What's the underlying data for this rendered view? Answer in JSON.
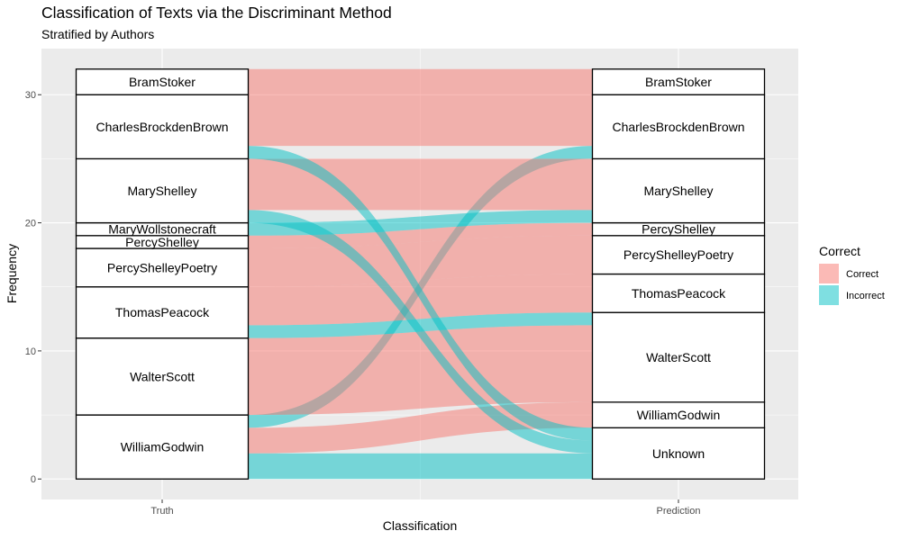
{
  "chart_data": {
    "type": "alluvial",
    "title": "Classification of Texts via the Discriminant Method",
    "subtitle": "Stratified by Authors",
    "xlabel": "Classification",
    "ylabel": "Frequency",
    "axes": [
      "Truth",
      "Prediction"
    ],
    "ylim": [
      -1.6,
      33.6
    ],
    "yticks": [
      0,
      10,
      20,
      30
    ],
    "legend": {
      "title": "Correct",
      "position": "right",
      "entries": [
        {
          "label": "Correct",
          "color": "#F8766D"
        },
        {
          "label": "Incorrect",
          "color": "#00BFC4"
        }
      ]
    },
    "truth_strata": [
      {
        "label": "WilliamGodwin",
        "count": 5
      },
      {
        "label": "WalterScott",
        "count": 6
      },
      {
        "label": "ThomasPeacock",
        "count": 4
      },
      {
        "label": "PercyShelleyPoetry",
        "count": 3
      },
      {
        "label": "PercyShelley",
        "count": 1
      },
      {
        "label": "MaryWollstonecraft",
        "count": 1
      },
      {
        "label": "MaryShelley",
        "count": 5
      },
      {
        "label": "CharlesBrockdenBrown",
        "count": 5
      },
      {
        "label": "BramStoker",
        "count": 2
      }
    ],
    "prediction_strata": [
      {
        "label": "Unknown",
        "count": 4
      },
      {
        "label": "WilliamGodwin",
        "count": 2
      },
      {
        "label": "WalterScott",
        "count": 7
      },
      {
        "label": "ThomasPeacock",
        "count": 3
      },
      {
        "label": "PercyShelleyPoetry",
        "count": 3
      },
      {
        "label": "PercyShelley",
        "count": 1
      },
      {
        "label": "MaryShelley",
        "count": 5
      },
      {
        "label": "CharlesBrockdenBrown",
        "count": 5
      },
      {
        "label": "BramStoker",
        "count": 2
      }
    ],
    "flows": [
      {
        "from": "WilliamGodwin",
        "to": "Unknown",
        "count": 2,
        "correct": "Incorrect"
      },
      {
        "from": "WilliamGodwin",
        "to": "WilliamGodwin",
        "count": 2,
        "correct": "Correct"
      },
      {
        "from": "WilliamGodwin",
        "to": "CharlesBrockdenBrown",
        "count": 1,
        "correct": "Incorrect"
      },
      {
        "from": "WalterScott",
        "to": "WalterScott",
        "count": 6,
        "correct": "Correct"
      },
      {
        "from": "ThomasPeacock",
        "to": "WalterScott",
        "count": 1,
        "correct": "Incorrect"
      },
      {
        "from": "ThomasPeacock",
        "to": "ThomasPeacock",
        "count": 3,
        "correct": "Correct"
      },
      {
        "from": "PercyShelleyPoetry",
        "to": "PercyShelleyPoetry",
        "count": 3,
        "correct": "Correct"
      },
      {
        "from": "PercyShelley",
        "to": "PercyShelley",
        "count": 1,
        "correct": "Correct"
      },
      {
        "from": "MaryWollstonecraft",
        "to": "MaryShelley",
        "count": 1,
        "correct": "Incorrect"
      },
      {
        "from": "MaryShelley",
        "to": "Unknown",
        "count": 1,
        "correct": "Incorrect"
      },
      {
        "from": "MaryShelley",
        "to": "MaryShelley",
        "count": 4,
        "correct": "Correct"
      },
      {
        "from": "CharlesBrockdenBrown",
        "to": "Unknown",
        "count": 1,
        "correct": "Incorrect"
      },
      {
        "from": "CharlesBrockdenBrown",
        "to": "CharlesBrockdenBrown",
        "count": 4,
        "correct": "Correct"
      },
      {
        "from": "BramStoker",
        "to": "BramStoker",
        "count": 2,
        "correct": "Correct"
      }
    ]
  }
}
